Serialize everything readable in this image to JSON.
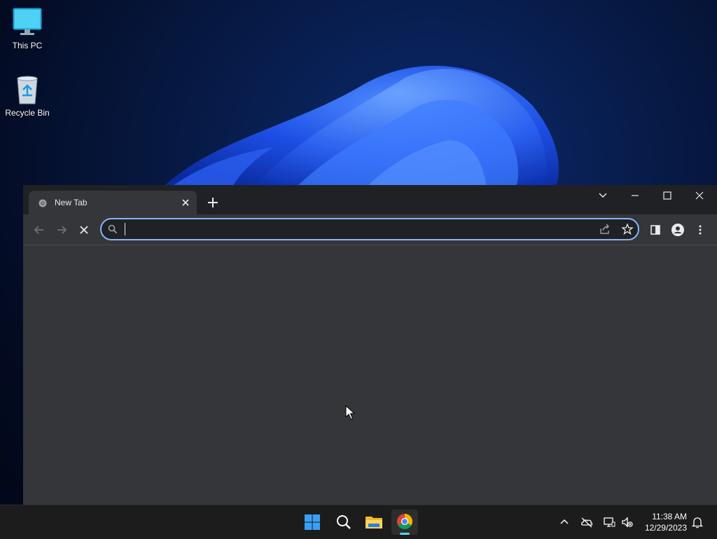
{
  "desktop": {
    "icons": [
      {
        "label": "This PC",
        "icon": "monitor-icon"
      },
      {
        "label": "Recycle Bin",
        "icon": "recycle-bin-icon"
      }
    ]
  },
  "browser": {
    "tabs": [
      {
        "title": "New Tab",
        "icon": "chrome-favicon-icon"
      }
    ],
    "omnibox": {
      "value": "",
      "placeholder": ""
    },
    "colors": {
      "frame": "#202124",
      "toolbar": "#35363a",
      "focus_ring": "#8ab4f8"
    }
  },
  "taskbar": {
    "items": [
      {
        "name": "start",
        "icon": "windows-logo-icon"
      },
      {
        "name": "search",
        "icon": "search-icon"
      },
      {
        "name": "file-explorer",
        "icon": "folder-icon"
      },
      {
        "name": "chrome",
        "icon": "chrome-icon",
        "active": true
      }
    ],
    "clock": {
      "time": "11:38 AM",
      "date": "12/29/2023"
    }
  }
}
